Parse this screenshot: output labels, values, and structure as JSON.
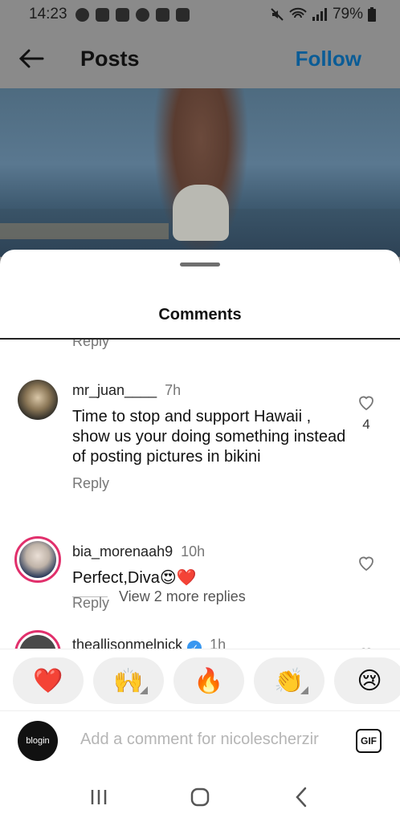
{
  "status_bar": {
    "time": "14:23",
    "battery": "79%"
  },
  "header": {
    "title": "Posts",
    "follow_label": "Follow"
  },
  "sheet": {
    "title": "Comments"
  },
  "comments": {
    "cut_reply": "Reply",
    "items": [
      {
        "username": "mr_juan____",
        "time": "7h",
        "text": "Time to stop and support Hawaii , show us your doing something instead of posting pictures in bikini",
        "reply": "Reply",
        "likes": "4"
      },
      {
        "username": "bia_morenaah9",
        "time": "10h",
        "text": "Perfect,Diva😍❤️",
        "reply": "Reply"
      },
      {
        "username": "theallisonmelnick",
        "time": "1h"
      }
    ],
    "view_more": "View 2 more replies"
  },
  "reactions": [
    "❤️",
    "🙌",
    "🔥",
    "👏",
    "😢"
  ],
  "input": {
    "avatar_text": "blogin",
    "placeholder": "Add a comment for nicolescherzir",
    "gif_label": "GIF"
  },
  "colors": {
    "follow": "#0a5c96",
    "story_ring": "#e1306c",
    "verified": "#3897f0"
  }
}
